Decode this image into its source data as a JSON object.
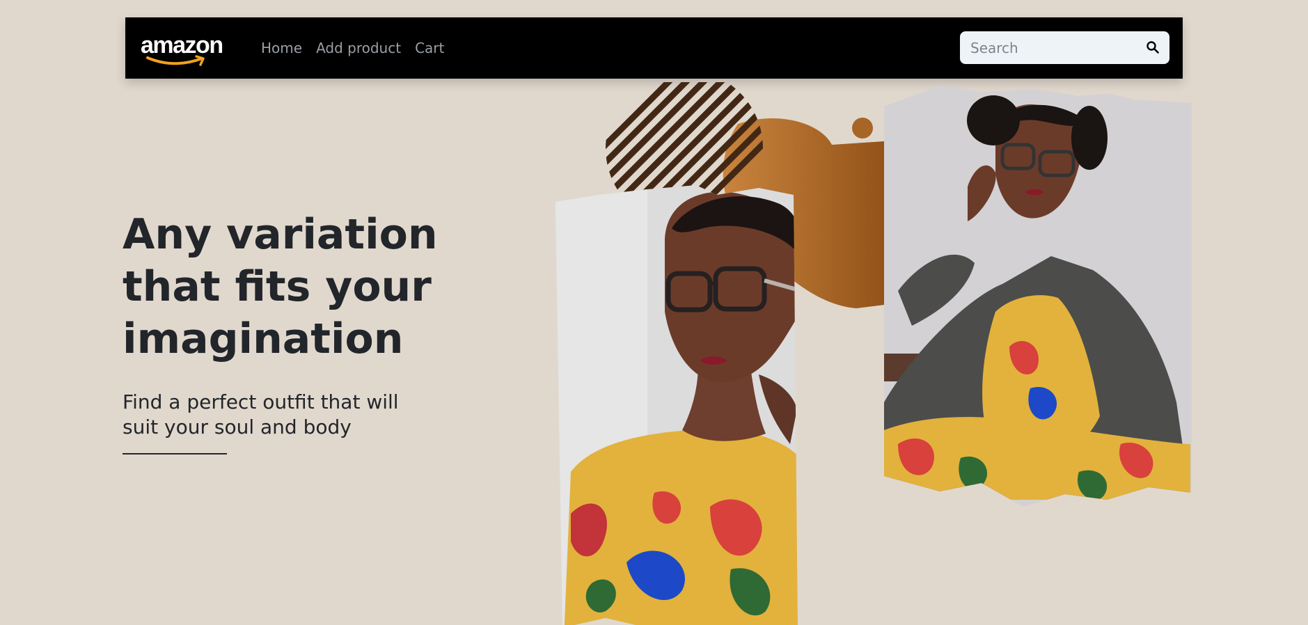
{
  "navbar": {
    "logo_text": "amazon",
    "links": [
      {
        "label": "Home"
      },
      {
        "label": "Add product"
      },
      {
        "label": "Cart"
      }
    ],
    "search": {
      "placeholder": "Search",
      "value": ""
    },
    "icons": {
      "search": "search-icon"
    }
  },
  "hero": {
    "title": "Any variation that fits your imagination",
    "subtitle": "Find a perfect outfit that will suit your soul and body"
  },
  "colors": {
    "background": "#e1d8cd",
    "navbar": "#000000",
    "text": "#22252a",
    "accent_orange": "#a86528",
    "dress_yellow": "#e2b23c"
  }
}
